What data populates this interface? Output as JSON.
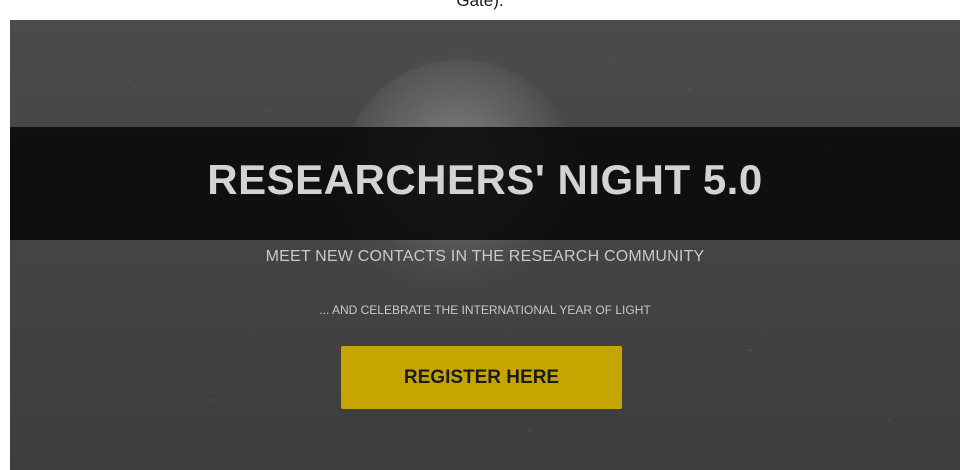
{
  "top_fragment": "Gate).",
  "hero": {
    "title": "RESEARCHERS' NIGHT 5.0",
    "subtitle": "MEET NEW CONTACTS IN THE RESEARCH COMMUNITY",
    "tagline": "... AND CELEBRATE THE INTERNATIONAL YEAR OF LIGHT",
    "register_label": "REGISTER HERE"
  },
  "colors": {
    "accent_button": "#c7a500",
    "title_band": "#080808",
    "hero_background": "#474747",
    "text_light": "#d3d3d3"
  },
  "icons": {
    "decor": "moon-image"
  }
}
